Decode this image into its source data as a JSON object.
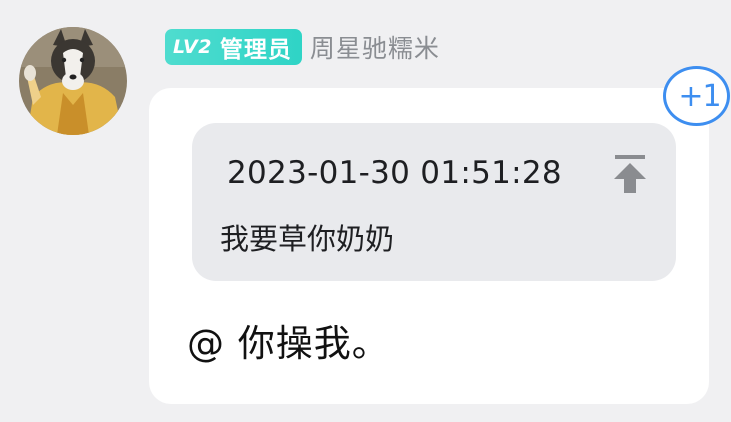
{
  "user": {
    "level_badge": "LV2",
    "role_badge": "管理员",
    "display_name": "周星驰糯米",
    "avatar_icon": "husky-dog-avatar"
  },
  "message": {
    "quote": {
      "timestamp": "2023-01-30 01:51:28",
      "text": "我要草你奶奶",
      "jump_icon": "arrow-to-top-icon"
    },
    "text": "@ 你操我。",
    "reaction_count": "+1"
  },
  "colors": {
    "background": "#f0f0f2",
    "bubble": "#ffffff",
    "quote_bg": "#e9eaed",
    "badge": "#2fd4c6",
    "username": "#8a8d92",
    "accent": "#3d8ef0"
  }
}
